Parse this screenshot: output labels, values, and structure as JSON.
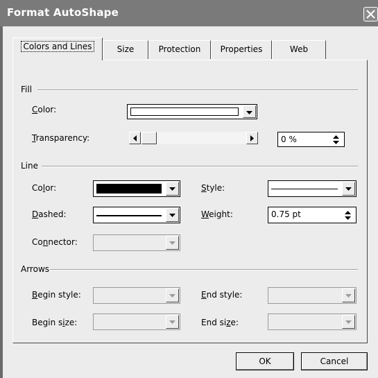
{
  "window": {
    "title": "Format AutoShape"
  },
  "tabs": [
    {
      "label": "Colors and Lines",
      "active": true
    },
    {
      "label": "Size"
    },
    {
      "label": "Protection"
    },
    {
      "label": "Properties"
    },
    {
      "label": "Web"
    }
  ],
  "fill": {
    "group_label": "Fill",
    "color_label": "Color:",
    "color_value": "#ffffff",
    "transparency_label": "Transparency:",
    "transparency_value": "0 %",
    "transparency_level": 0
  },
  "line": {
    "group_label": "Line",
    "color_label": "Color:",
    "color_value": "#000000",
    "style_label": "Style:",
    "dashed_label": "Dashed:",
    "weight_label": "Weight:",
    "weight_value": "0.75 pt",
    "connector_label": "Connector:"
  },
  "arrows": {
    "group_label": "Arrows",
    "begin_style_label": "Begin style:",
    "end_style_label": "End style:",
    "begin_size_label": "Begin size:",
    "end_size_label": "End size:"
  },
  "buttons": {
    "ok": "OK",
    "cancel": "Cancel"
  }
}
